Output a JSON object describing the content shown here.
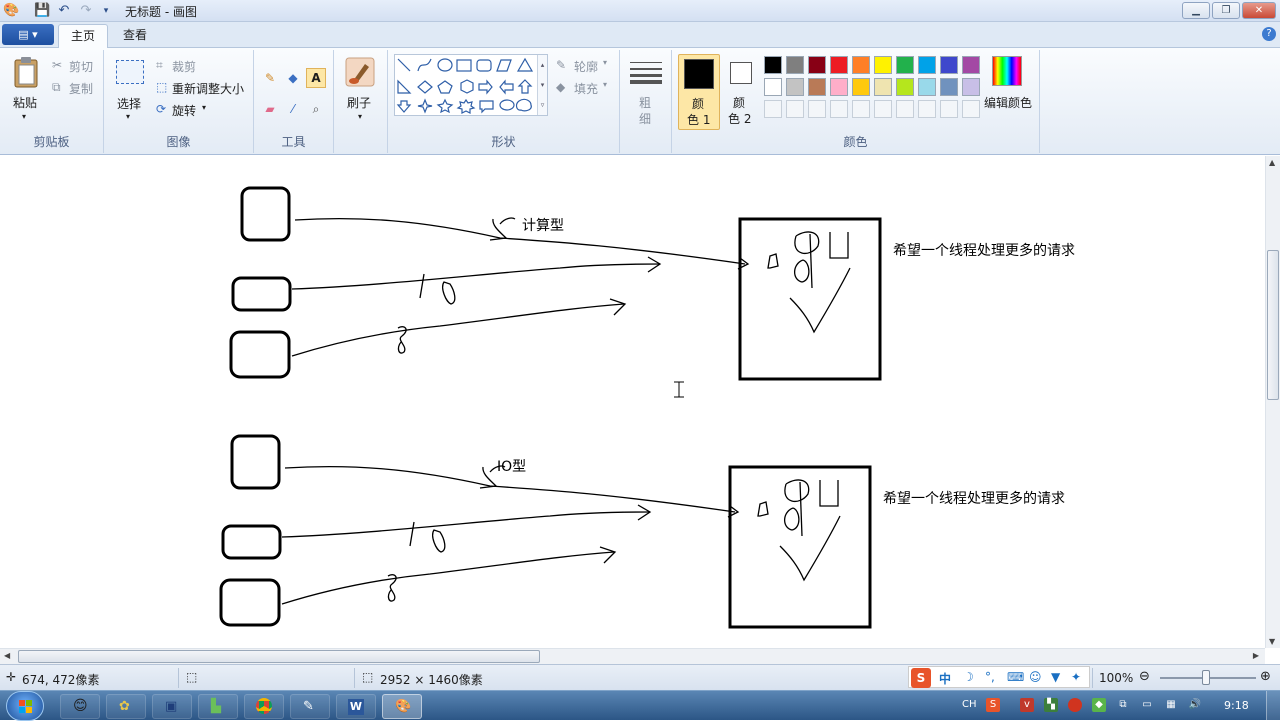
{
  "window": {
    "title": "无标题 - 画图"
  },
  "tabs": [
    {
      "label": "主页",
      "active": true
    },
    {
      "label": "查看",
      "active": false
    }
  ],
  "ribbon": {
    "clipboard": {
      "paste": "粘贴",
      "cut": "剪切",
      "copy": "复制",
      "group": "剪贴板"
    },
    "image": {
      "select": "选择",
      "crop": "裁剪",
      "resize": "重新调整大小",
      "rotate": "旋转",
      "group": "图像"
    },
    "tools": {
      "group": "工具"
    },
    "brushes": {
      "label": "刷子"
    },
    "shapes": {
      "outline": "轮廓",
      "fill": "填充",
      "group": "形状"
    },
    "size": {
      "line1": "粗",
      "line2": "细"
    },
    "colors": {
      "color1_line1": "颜",
      "color1_line2": "色 1",
      "color2_line1": "颜",
      "color2_line2": "色 2",
      "edit": "编辑颜色",
      "group": "颜色",
      "color1": "#000000",
      "color2": "#ffffff",
      "palette_row1": [
        "#000000",
        "#7f7f7f",
        "#880015",
        "#ed1c24",
        "#ff7f27",
        "#fff200",
        "#22b14c",
        "#00a2e8",
        "#3f48cc",
        "#a349a4"
      ],
      "palette_row2": [
        "#ffffff",
        "#c3c3c3",
        "#b97a57",
        "#ffaec9",
        "#ffc90e",
        "#efe4b0",
        "#b5e61d",
        "#99d9ea",
        "#7092be",
        "#c8bfe7"
      ]
    }
  },
  "canvas": {
    "label_compute": "计算型",
    "label_io": "IO型",
    "note_top": "希望一个线程处理更多的请求",
    "note_bottom": "希望一个线程处理更多的请求"
  },
  "status": {
    "cursor_pos": "674, 472像素",
    "image_size": "2952 × 1460像素",
    "zoom": "100%"
  },
  "taskbar": {
    "ime": "CH",
    "clock": "9:18"
  },
  "ime_bar": {
    "mode": "中"
  }
}
